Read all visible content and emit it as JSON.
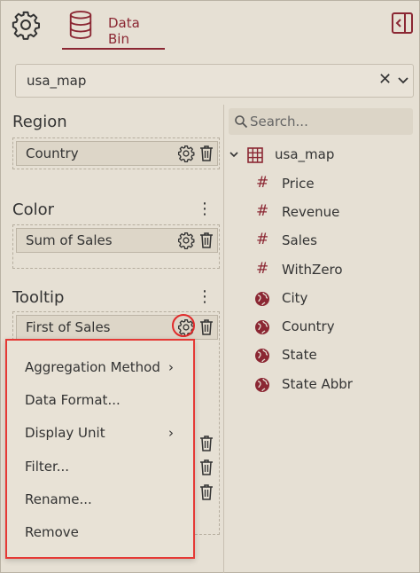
{
  "header": {
    "tabs": [
      {
        "label": "",
        "icon": "gear-icon"
      },
      {
        "label": "Data Bin",
        "icon": "database-icon",
        "active": true
      }
    ],
    "panel_toggle_icon": "panel-toggle-icon"
  },
  "dataset": {
    "value": "usa_map",
    "clear_symbol": "✕"
  },
  "sections": {
    "region": {
      "title": "Region",
      "item": "Country"
    },
    "color": {
      "title": "Color",
      "item": "Sum of Sales",
      "menu_symbol": "⋮"
    },
    "tooltip": {
      "title": "Tooltip",
      "item": "First of Sales",
      "menu_symbol": "⋮"
    }
  },
  "search": {
    "placeholder": "Search..."
  },
  "tree": {
    "root": "usa_map",
    "fields": [
      {
        "label": "Price",
        "type": "measure",
        "symbol": "#"
      },
      {
        "label": "Revenue",
        "type": "measure",
        "symbol": "#"
      },
      {
        "label": "Sales",
        "type": "measure",
        "symbol": "#"
      },
      {
        "label": "WithZero",
        "type": "measure",
        "symbol": "#"
      },
      {
        "label": "City",
        "type": "geo"
      },
      {
        "label": "Country",
        "type": "geo"
      },
      {
        "label": "State",
        "type": "geo"
      },
      {
        "label": "State Abbr",
        "type": "geo"
      }
    ]
  },
  "context_menu": {
    "submenu_arrow": "›",
    "items": [
      {
        "label": "Aggregation Method",
        "submenu": true
      },
      {
        "label": "Data Format..."
      },
      {
        "label": "Display Unit",
        "submenu": true
      },
      {
        "label": "Filter..."
      },
      {
        "label": "Rename..."
      },
      {
        "label": "Remove"
      }
    ]
  },
  "colors": {
    "accent": "#8b2733",
    "highlight": "#e53935",
    "background": "#e6e0d4"
  }
}
